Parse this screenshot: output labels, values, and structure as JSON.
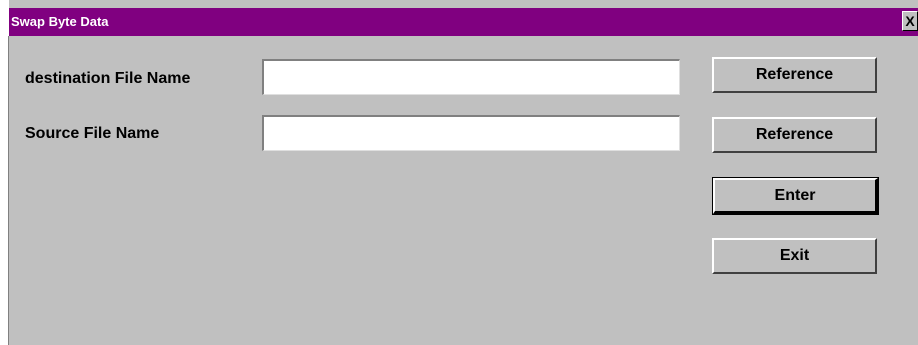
{
  "window": {
    "title": "Swap Byte Data",
    "close_label": "X"
  },
  "form": {
    "destination_label": "destination File Name",
    "destination_value": "",
    "source_label": "Source File Name",
    "source_value": ""
  },
  "buttons": {
    "reference_destination": "Reference",
    "reference_source": "Reference",
    "enter": "Enter",
    "exit": "Exit"
  },
  "colors": {
    "titlebar": "#800080",
    "face": "#c0c0c0"
  }
}
